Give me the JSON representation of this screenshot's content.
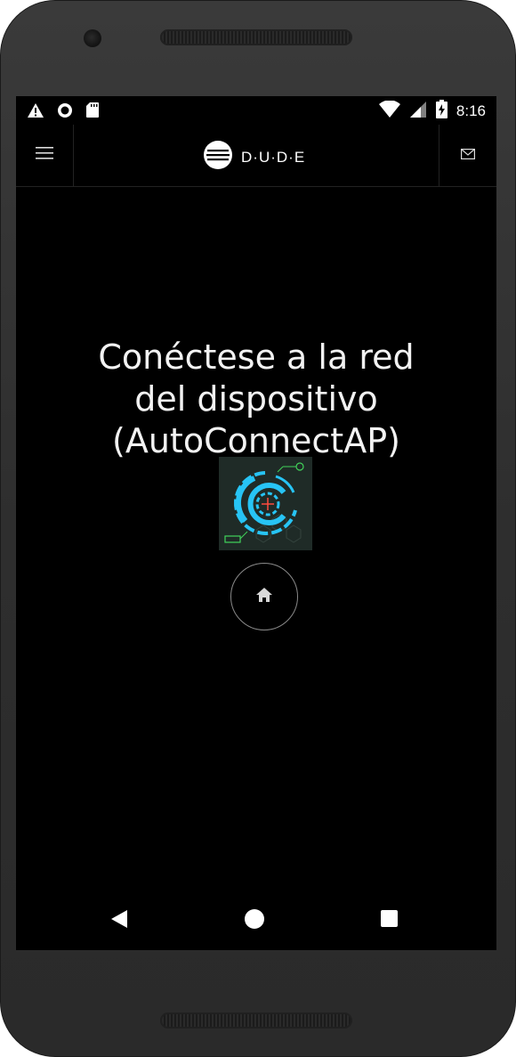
{
  "status_bar": {
    "time": "8:16",
    "left_icons": [
      "warning-icon",
      "record-icon",
      "sd-card-icon"
    ],
    "right_icons": [
      "wifi-icon",
      "cellular-icon",
      "battery-charging-icon"
    ]
  },
  "app_bar": {
    "brand_text": "D·U·D·E",
    "left_icon": "hamburger-menu-icon",
    "right_icon": "mail-icon",
    "logo_icon": "dude-logo-icon"
  },
  "content": {
    "headline_lines": [
      "Conéctese a la red",
      "del dispositivo",
      "(AutoConnectAP)"
    ],
    "image_icon": "hud-target-image",
    "home_icon": "home-icon"
  },
  "nav_bar": {
    "icons": [
      "back-icon",
      "home-nav-icon",
      "recents-icon"
    ]
  },
  "colors": {
    "screen_bg": "#000000",
    "text": "#f2f2f2",
    "device_frame": "#2e2e2e",
    "accent_cyan": "#27c4f5",
    "image_bg": "#1f2b27",
    "home_ring": "#8a8a8a"
  }
}
